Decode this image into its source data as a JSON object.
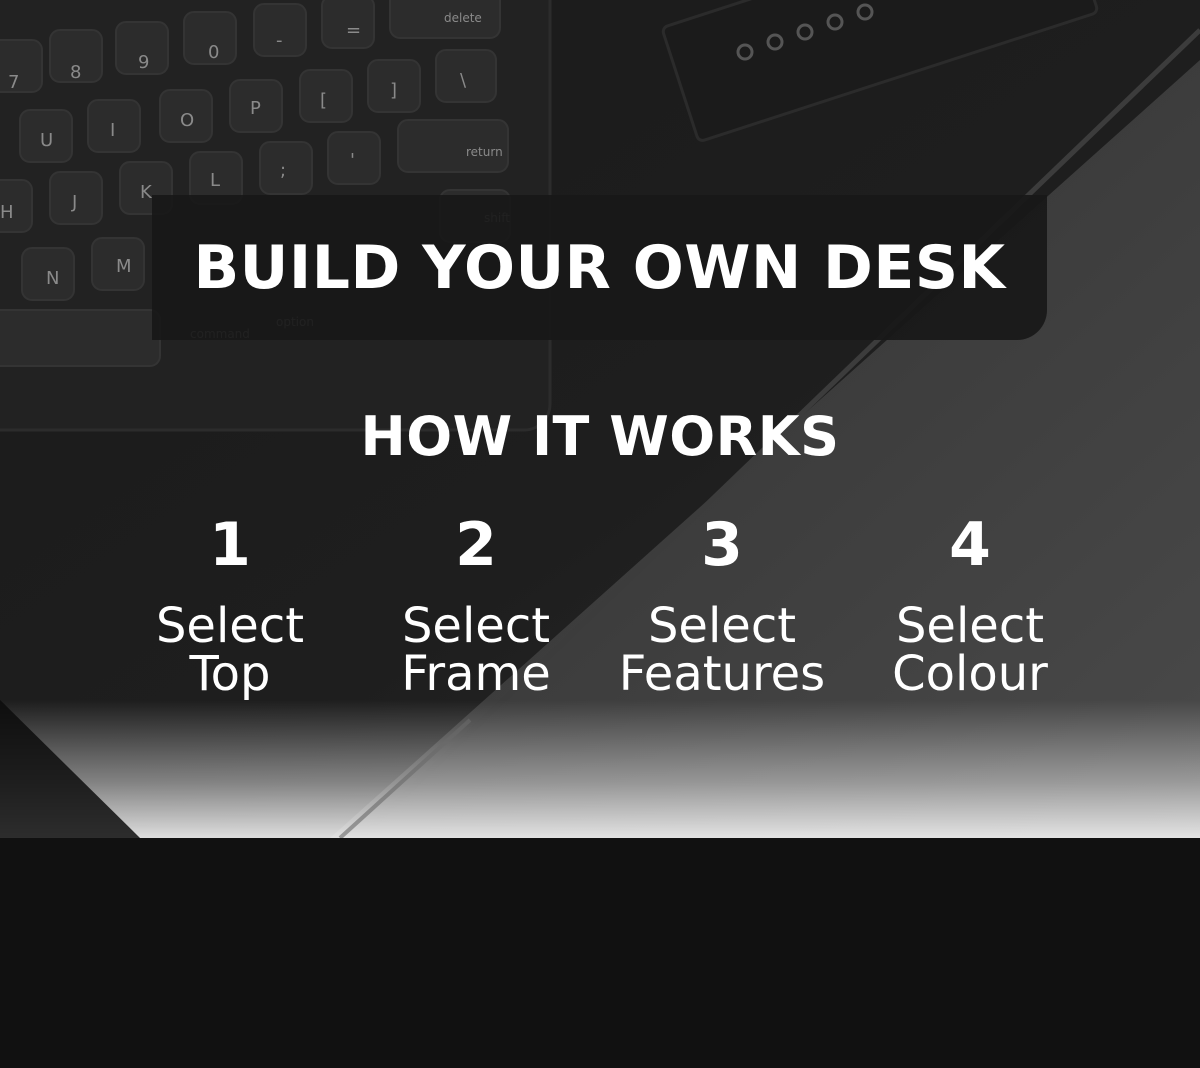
{
  "hero": {
    "title": "BUILD YOUR OWN DESK",
    "subtitle": "HOW IT WORKS"
  },
  "keyboard": {
    "keys": [
      "delete",
      "return",
      "shift",
      "command",
      "option"
    ]
  },
  "steps": [
    {
      "number": "1",
      "line1": "Select",
      "line2": "Top"
    },
    {
      "number": "2",
      "line1": "Select",
      "line2": "Frame"
    },
    {
      "number": "3",
      "line1": "Select",
      "line2": "Features"
    },
    {
      "number": "4",
      "line1": "Select",
      "line2": "Colour"
    }
  ],
  "colors": {
    "background": "#111111",
    "title_band": "#181818",
    "text": "#ffffff"
  }
}
